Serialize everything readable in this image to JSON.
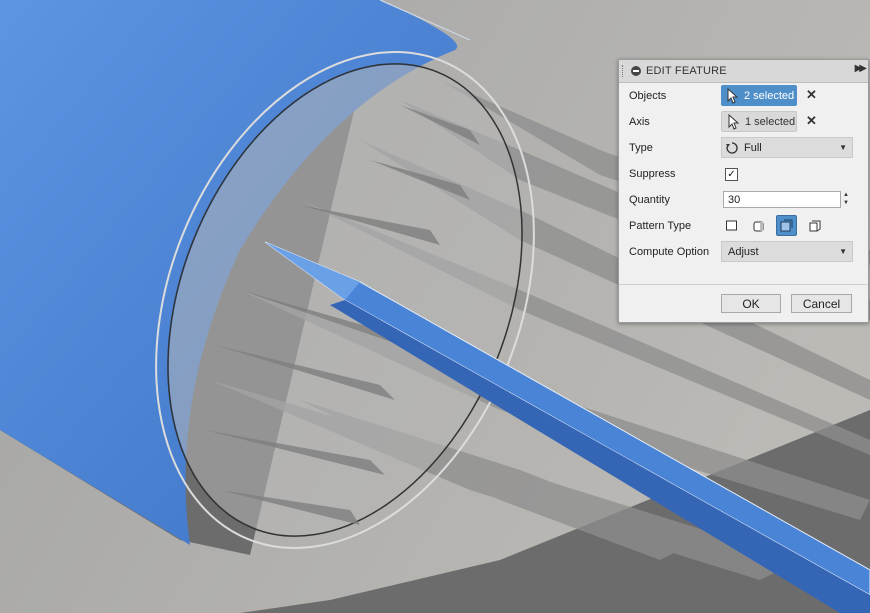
{
  "panel": {
    "title": "EDIT FEATURE",
    "objects": {
      "label": "Objects",
      "value": "2 selected"
    },
    "axis": {
      "label": "Axis",
      "value": "1 selected"
    },
    "type": {
      "label": "Type",
      "value": "Full",
      "icon": "full-circle-arrow-icon"
    },
    "suppress": {
      "label": "Suppress",
      "checked": true,
      "mark": "✓"
    },
    "quantity": {
      "label": "Quantity",
      "value": "30"
    },
    "pattern_type": {
      "label": "Pattern Type",
      "options_icons": [
        "faces-icon",
        "bodies-icon",
        "features-icon",
        "components-icon"
      ],
      "selected_index": 2
    },
    "compute_option": {
      "label": "Compute Option",
      "value": "Adjust"
    },
    "ok_label": "OK",
    "cancel_label": "Cancel"
  },
  "colors": {
    "accent": "#4f8fc9",
    "model_blue": "#4a84d6",
    "background": "#6b6b6b"
  }
}
